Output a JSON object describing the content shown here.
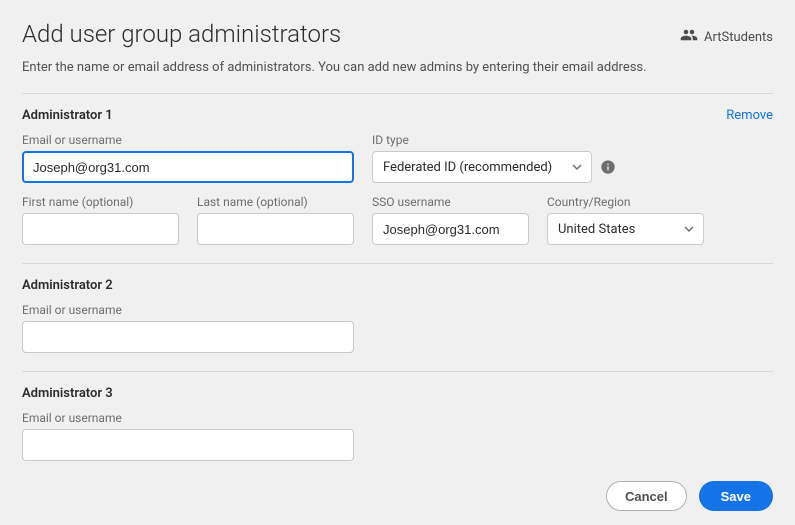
{
  "header": {
    "title": "Add user group administrators",
    "group_name": "ArtStudents",
    "instructions": "Enter the name or email address of administrators. You can add new admins by entering their email address."
  },
  "labels": {
    "email_or_username": "Email or username",
    "id_type": "ID type",
    "first_name": "First name (optional)",
    "last_name": "Last name (optional)",
    "sso_username": "SSO username",
    "country_region": "Country/Region",
    "remove": "Remove"
  },
  "admins": [
    {
      "title": "Administrator 1",
      "expanded": true,
      "email_value": "Joseph@org31.com",
      "id_type_value": "Federated ID (recommended)",
      "first_name_value": "",
      "last_name_value": "",
      "sso_username_value": "Joseph@org31.com",
      "country_value": "United States",
      "removable": true
    },
    {
      "title": "Administrator 2",
      "expanded": false,
      "email_value": ""
    },
    {
      "title": "Administrator 3",
      "expanded": false,
      "email_value": ""
    }
  ],
  "footer": {
    "cancel": "Cancel",
    "save": "Save"
  }
}
